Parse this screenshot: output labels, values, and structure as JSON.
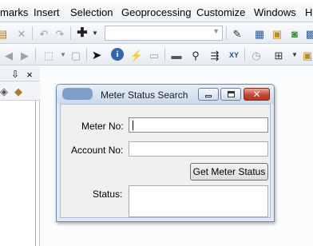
{
  "menubar": {
    "items": [
      "marks",
      "Insert",
      "Selection",
      "Geoprocessing",
      "Customize",
      "Windows",
      "H"
    ]
  },
  "toolbar_combo": {
    "value": ""
  },
  "dialog": {
    "title": "Meter Status Search",
    "meter_no_label": "Meter No:",
    "meter_no_value": "",
    "account_no_label": "Account No:",
    "account_no_value": "",
    "get_status_button": "Get Meter Status",
    "status_label": "Status:",
    "status_value": ""
  },
  "icons": {
    "close": "×",
    "undo": "↶",
    "redo": "↷",
    "info": "i"
  },
  "colors": {
    "dialog_border": "#6d8bb1",
    "close_button": "#c7472e",
    "focus_border": "#5c93d0"
  }
}
